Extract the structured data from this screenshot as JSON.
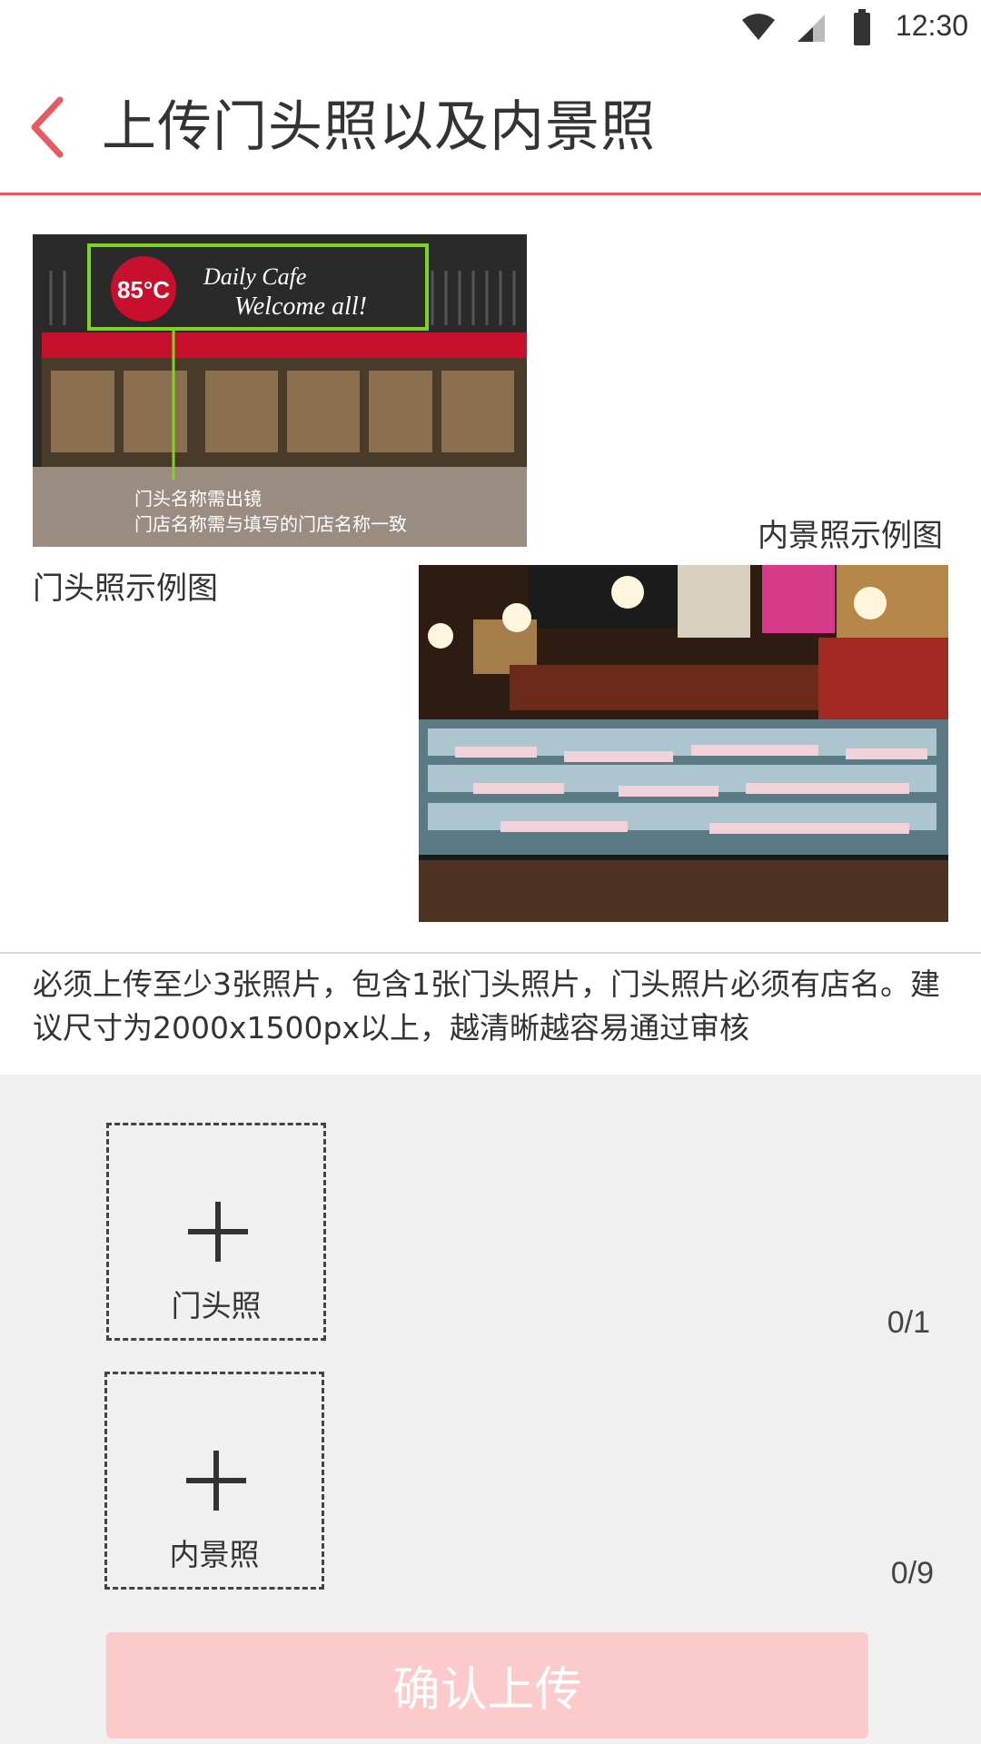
{
  "status_bar": {
    "time": "12:30",
    "icons": [
      "wifi-icon",
      "signal-icon",
      "battery-icon"
    ]
  },
  "header": {
    "back_icon": "chevron-left-icon",
    "title": "上传门头照以及内景照"
  },
  "samples": {
    "storefront": {
      "caption": "门头照示例图",
      "image_overlay_text": [
        "门头名称需出镜",
        "门店名称需与填写的门店名称一致"
      ],
      "sign_text": [
        "85°C",
        "Daily Cafe",
        "Welcome all!"
      ]
    },
    "interior": {
      "caption": "内景照示例图"
    }
  },
  "notice": "必须上传至少3张照片，包含1张门头照片，门头照片必须有店名。建议尺寸为2000x1500px以上，越清晰越容易通过审核",
  "uploads": {
    "storefront": {
      "label": "门头照",
      "count": "0/1"
    },
    "interior": {
      "label": "内景照",
      "count": "0/9"
    }
  },
  "confirm_button": "确认上传",
  "colors": {
    "accent": "#e85a62",
    "button_disabled": "#fdcacb",
    "upload_bg": "#f0f0f0"
  }
}
